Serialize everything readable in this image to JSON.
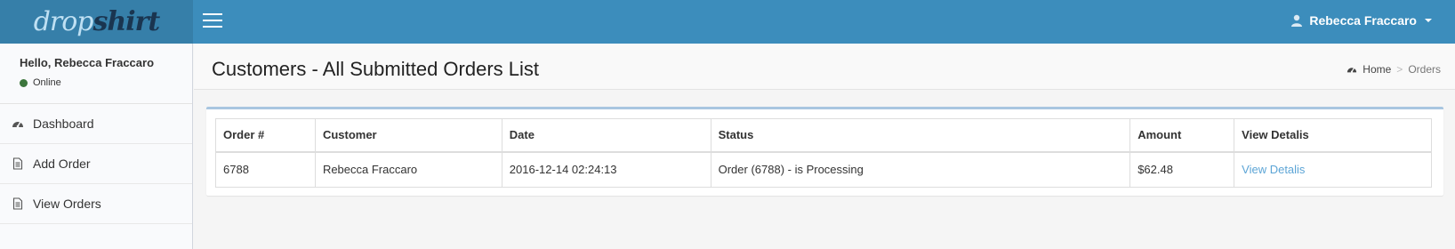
{
  "brand": {
    "logo_part1": "drop",
    "logo_part2": "shirt"
  },
  "header": {
    "user_name": "Rebecca Fraccaro"
  },
  "sidebar": {
    "greeting": "Hello, Rebecca Fraccaro",
    "status": "Online",
    "status_color": "#3c763d",
    "items": [
      {
        "label": "Dashboard",
        "icon": "dashboard-icon"
      },
      {
        "label": "Add Order",
        "icon": "document-icon"
      },
      {
        "label": "View Orders",
        "icon": "document-icon"
      }
    ]
  },
  "page": {
    "title": "Customers - All Submitted Orders List",
    "breadcrumb": {
      "home": "Home",
      "current": "Orders"
    }
  },
  "table": {
    "headers": [
      "Order #",
      "Customer",
      "Date",
      "Status",
      "Amount",
      "View Detalis"
    ],
    "rows": [
      [
        "6788",
        "Rebecca Fraccaro",
        "2016-12-14 02:24:13",
        "Order (6788) - is Processing",
        "$62.48",
        "View Detalis"
      ]
    ]
  },
  "colors": {
    "accent": "#3c8dbc",
    "accent_dark": "#367fa9",
    "link": "#5da5d6"
  }
}
